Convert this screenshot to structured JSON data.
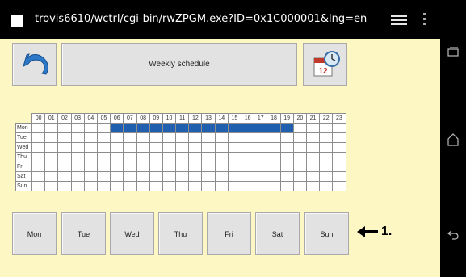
{
  "statusbar": {
    "url": "trovis6610/wctrl/cgi-bin/rwZPGM.exe?ID=0x1C000001&lng=en"
  },
  "toolbar": {
    "back_icon": "undo-arrow-icon",
    "title": "Weekly schedule",
    "calendar_icon": "calendar-clock-icon",
    "calendar_day": "12"
  },
  "schedule": {
    "hours": [
      "00",
      "01",
      "02",
      "03",
      "04",
      "05",
      "06",
      "07",
      "08",
      "09",
      "10",
      "11",
      "12",
      "13",
      "14",
      "15",
      "16",
      "17",
      "18",
      "19",
      "20",
      "21",
      "22",
      "23"
    ],
    "days": [
      {
        "label": "Mon",
        "active_hours": [
          6,
          7,
          8,
          9,
          10,
          11,
          12,
          13,
          14,
          15,
          16,
          17,
          18,
          19
        ]
      },
      {
        "label": "Tue",
        "active_hours": []
      },
      {
        "label": "Wed",
        "active_hours": []
      },
      {
        "label": "Thu",
        "active_hours": []
      },
      {
        "label": "Fri",
        "active_hours": []
      },
      {
        "label": "Sat",
        "active_hours": []
      },
      {
        "label": "Sun",
        "active_hours": []
      }
    ],
    "active_color": "#1f5fae"
  },
  "day_buttons": [
    "Mon",
    "Tue",
    "Wed",
    "Thu",
    "Fri",
    "Sat",
    "Sun"
  ],
  "annotation": {
    "label": "1."
  }
}
